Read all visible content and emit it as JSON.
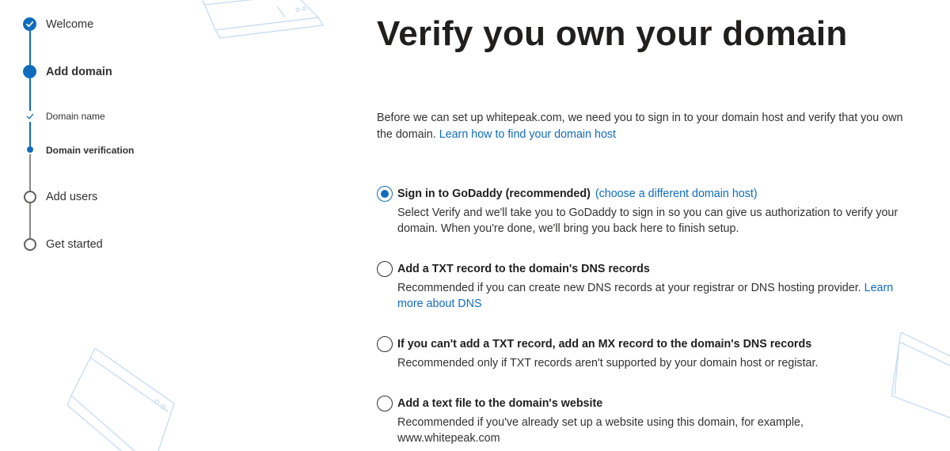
{
  "stepper": {
    "steps": [
      {
        "label": "Welcome",
        "state": "completed"
      },
      {
        "label": "Add domain",
        "state": "current"
      },
      {
        "label": "Domain name",
        "state": "completed-substep"
      },
      {
        "label": "Domain verification",
        "state": "current-substep"
      },
      {
        "label": "Add users",
        "state": "pending"
      },
      {
        "label": "Get started",
        "state": "pending"
      }
    ]
  },
  "main": {
    "title": "Verify you own your domain",
    "intro_text": "Before we can set up whitepeak.com, we need you to sign in to your domain host and verify that you own the domain.",
    "intro_link": "Learn how to find your domain host",
    "options": [
      {
        "label": "Sign in to GoDaddy (recommended)",
        "alt_link": "(choose a different domain host)",
        "description": "Select Verify and we'll take you to GoDaddy to sign in so you can give us authorization to verify your domain. When you're done, we'll bring you back here to finish setup.",
        "selected": true
      },
      {
        "label": "Add a TXT record to the domain's DNS records",
        "description": "Recommended if you can create new DNS records at your registrar or DNS hosting provider.",
        "desc_link": "Learn more about DNS",
        "selected": false
      },
      {
        "label": "If you can't add a TXT record, add an MX record to the domain's DNS records",
        "description": "Recommended only if TXT records aren't supported by your domain host or registar.",
        "selected": false
      },
      {
        "label": "Add a text file to the domain's website",
        "description": "Recommended if you've already set up a website using this domain, for example, www.whitepeak.com",
        "selected": false
      }
    ]
  },
  "colors": {
    "accent": "#0f6cbd",
    "text": "#323130",
    "decoration": "#c7dcf2"
  },
  "icons": [
    "checkmark-circle-icon",
    "checkmark-icon",
    "radio-selected-icon",
    "radio-empty-icon",
    "browser-window-illustration"
  ]
}
